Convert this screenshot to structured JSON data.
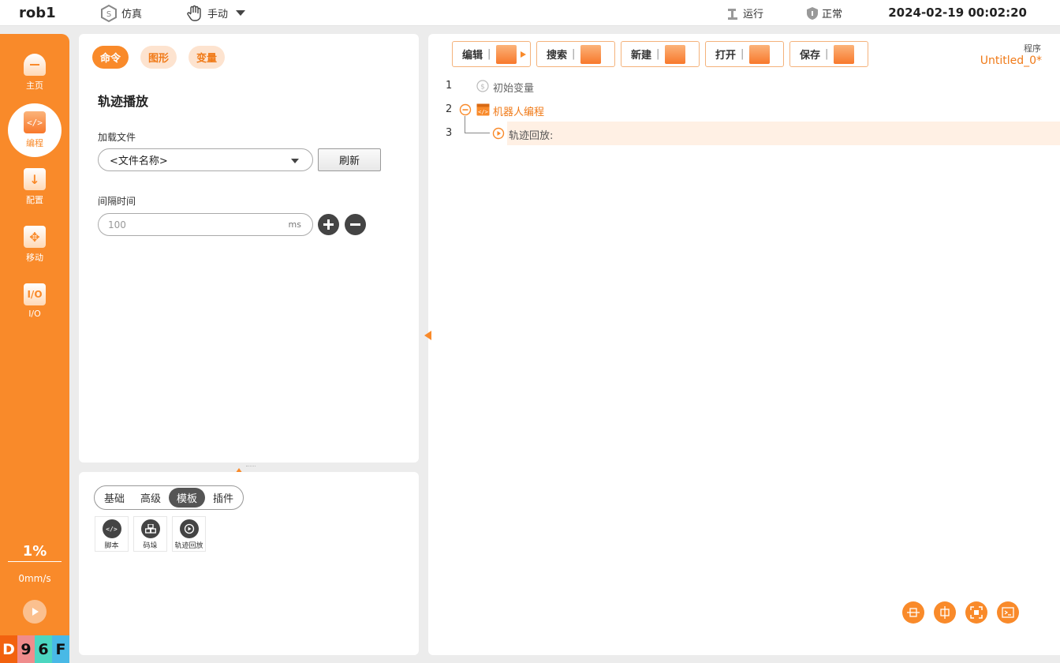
{
  "topbar": {
    "robot": "rob1",
    "sim_label": "仿真",
    "mode_label": "手动",
    "run_label": "运行",
    "status_label": "正常",
    "datetime": "2024-02-19 00:02:20"
  },
  "sidebar": {
    "items": [
      {
        "label": "主页",
        "icon": "home-icon"
      },
      {
        "label": "编程",
        "icon": "code-icon"
      },
      {
        "label": "配置",
        "icon": "download-icon"
      },
      {
        "label": "移动",
        "icon": "move-icon"
      },
      {
        "label": "I/O",
        "icon": "io-icon"
      }
    ],
    "speed_percent": "1%",
    "speed_value": "0mm/s",
    "code_chars": [
      "D",
      "9",
      "6",
      "F"
    ],
    "code_colors": [
      "#f2620f",
      "#ef8c8c",
      "#4cd6c0",
      "#49b9e6"
    ]
  },
  "command_panel": {
    "tabs": [
      "命令",
      "图形",
      "变量"
    ],
    "title": "轨迹播放",
    "load_file_label": "加载文件",
    "file_select_value": "<文件名称>",
    "refresh_label": "刷新",
    "interval_label": "间隔时间",
    "interval_placeholder": "100",
    "interval_unit": "ms"
  },
  "library_panel": {
    "tabs": [
      "基础",
      "高级",
      "模板",
      "插件"
    ],
    "active_tab": "模板",
    "tools": [
      {
        "label": "脚本",
        "icon": "script-icon"
      },
      {
        "label": "码垛",
        "icon": "palletize-icon"
      },
      {
        "label": "轨迹回放",
        "icon": "replay-icon"
      }
    ]
  },
  "program_panel": {
    "toolbar": [
      "编辑",
      "搜索",
      "新建",
      "打开",
      "保存"
    ],
    "program_label": "程序",
    "program_name": "Untitled_0*",
    "lines": [
      {
        "num": "1",
        "text": "初始变量"
      },
      {
        "num": "2",
        "text": "机器人编程"
      },
      {
        "num": "3",
        "text": "轨迹回放:"
      }
    ]
  },
  "colors": {
    "accent": "#f98a2a",
    "accent_light": "#fde3cf",
    "highlight_row": "#fff0e4"
  }
}
